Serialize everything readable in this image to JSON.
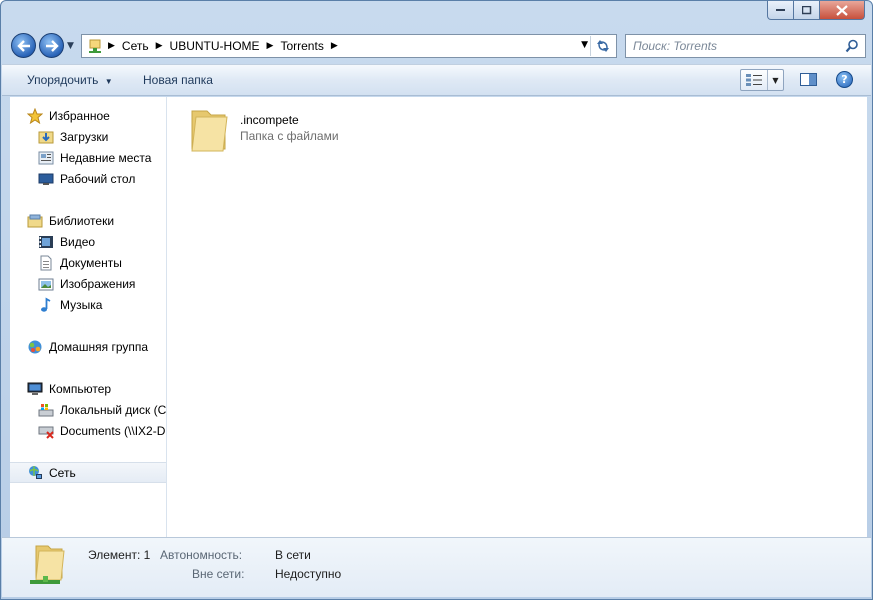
{
  "window": {
    "caption_buttons": {
      "minimize": "minimize",
      "maximize": "maximize",
      "close": "close"
    }
  },
  "address_bar": {
    "breadcrumbs": [
      "Сеть",
      "UBUNTU-HOME",
      "Torrents"
    ]
  },
  "search": {
    "placeholder": "Поиск: Torrents"
  },
  "toolbar": {
    "organize_label": "Упорядочить",
    "new_folder_label": "Новая папка"
  },
  "nav_pane": {
    "favorites": {
      "label": "Избранное",
      "items": [
        {
          "label": "Загрузки",
          "icon": "downloads-folder-icon"
        },
        {
          "label": "Недавние места",
          "icon": "recent-places-icon"
        },
        {
          "label": "Рабочий стол",
          "icon": "desktop-icon"
        }
      ]
    },
    "libraries": {
      "label": "Библиотеки",
      "items": [
        {
          "label": "Видео",
          "icon": "video-icon"
        },
        {
          "label": "Документы",
          "icon": "documents-icon"
        },
        {
          "label": "Изображения",
          "icon": "pictures-icon"
        },
        {
          "label": "Музыка",
          "icon": "music-icon"
        }
      ]
    },
    "homegroup": {
      "label": "Домашняя группа"
    },
    "computer": {
      "label": "Компьютер",
      "items": [
        {
          "label": "Локальный диск (C",
          "icon": "local-disk-icon"
        },
        {
          "label": "Documents (\\\\IX2-D",
          "icon": "network-drive-disconnected-icon"
        }
      ]
    },
    "network": {
      "label": "Сеть"
    }
  },
  "content": {
    "items": [
      {
        "name": ".incompete",
        "type": "Папка с файлами"
      }
    ]
  },
  "details": {
    "count_label": "Элемент: 1",
    "offline_label": "Автономность:",
    "offline_value": "В сети",
    "offline_avail_label": "Вне сети:",
    "offline_avail_value": "Недоступно"
  },
  "colors": {
    "chrome": "#c8daee",
    "toolbar": "#dfe9f5",
    "selection": "#e5ecf5",
    "folder": "#f0d98a"
  }
}
